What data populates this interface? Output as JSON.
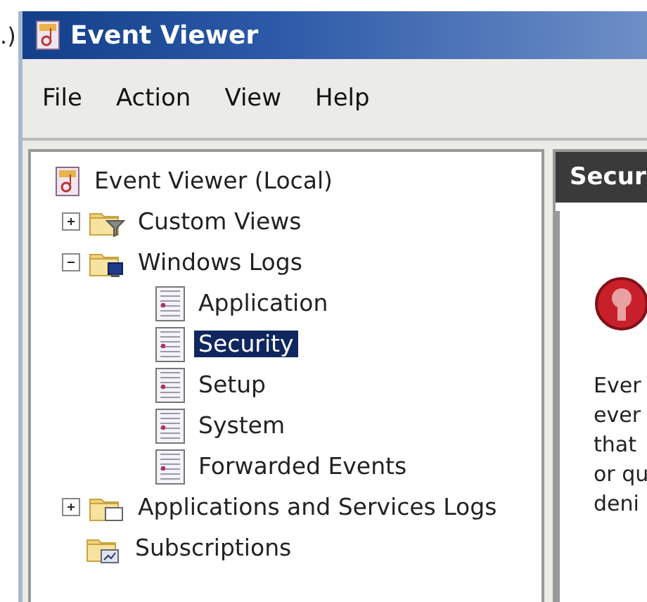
{
  "stray_text": ".)",
  "window": {
    "title": "Event Viewer"
  },
  "menu": [
    "File",
    "Action",
    "View",
    "Help"
  ],
  "tree": [
    {
      "label": "Event Viewer (Local)",
      "kind": "viewer",
      "selected": false,
      "children": [
        {
          "label": "Custom Views",
          "kind": "filter",
          "selected": false,
          "expanded": false
        },
        {
          "label": "Windows Logs",
          "kind": "logs",
          "selected": false,
          "expanded": true,
          "children": [
            {
              "label": "Application",
              "kind": "log",
              "selected": false
            },
            {
              "label": "Security",
              "kind": "log",
              "selected": true
            },
            {
              "label": "Setup",
              "kind": "log",
              "selected": false
            },
            {
              "label": "System",
              "kind": "log",
              "selected": false
            },
            {
              "label": "Forwarded Events",
              "kind": "log",
              "selected": false
            }
          ]
        },
        {
          "label": "Applications and Services Logs",
          "kind": "folder",
          "selected": false,
          "expanded": false
        },
        {
          "label": "Subscriptions",
          "kind": "subscriptions",
          "selected": false
        }
      ]
    }
  ],
  "detail": {
    "header": "Secur",
    "lines": [
      "Ever",
      "ever",
      "that",
      "or qu",
      "deni"
    ]
  }
}
